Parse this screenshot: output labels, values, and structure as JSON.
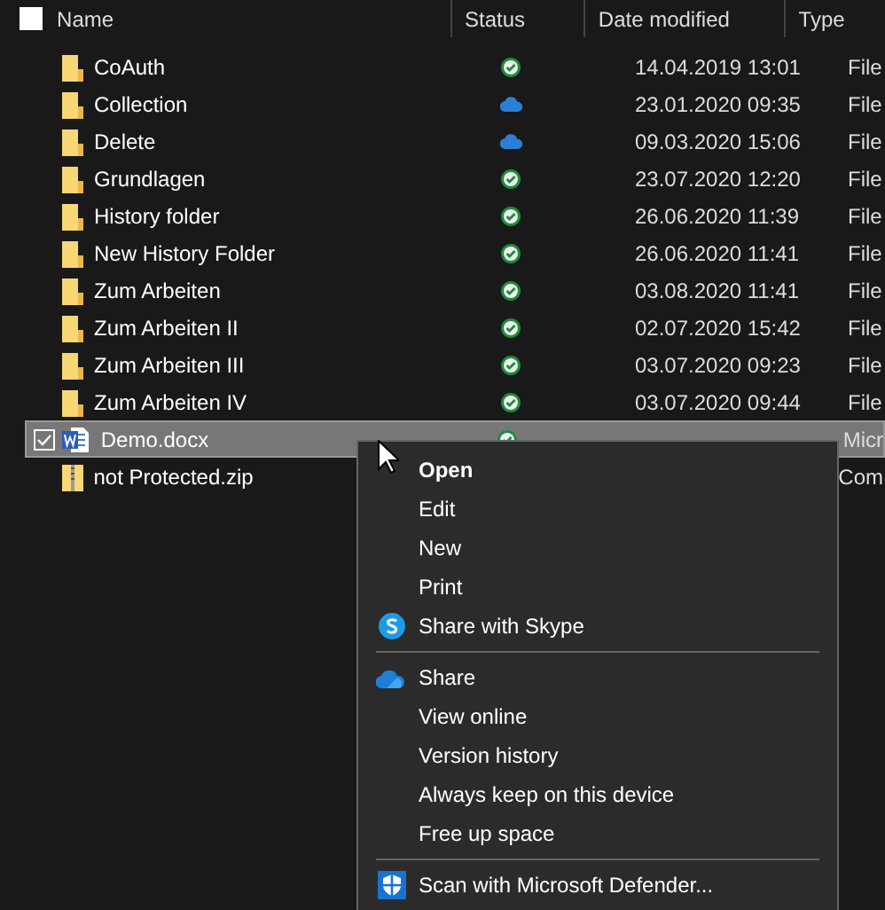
{
  "header": {
    "checked": false,
    "columns": [
      "Name",
      "Status",
      "Date modified",
      "Type"
    ]
  },
  "rows": [
    {
      "name": "CoAuth",
      "kind": "folder",
      "status": {
        "kind": "synced"
      },
      "date": "14.04.2019 13:01",
      "type": "File",
      "selected": false
    },
    {
      "name": "Collection",
      "kind": "folder",
      "status": {
        "kind": "cloud"
      },
      "date": "23.01.2020 09:35",
      "type": "File",
      "selected": false
    },
    {
      "name": "Delete",
      "kind": "folder",
      "status": {
        "kind": "cloud"
      },
      "date": "09.03.2020 15:06",
      "type": "File",
      "selected": false
    },
    {
      "name": "Grundlagen",
      "kind": "folder",
      "status": {
        "kind": "synced"
      },
      "date": "23.07.2020 12:20",
      "type": "File",
      "selected": false
    },
    {
      "name": "History folder",
      "kind": "folder",
      "status": {
        "kind": "synced"
      },
      "date": "26.06.2020 11:39",
      "type": "File",
      "selected": false
    },
    {
      "name": "New History Folder",
      "kind": "folder",
      "status": {
        "kind": "synced"
      },
      "date": "26.06.2020 11:41",
      "type": "File",
      "selected": false
    },
    {
      "name": "Zum Arbeiten",
      "kind": "folder",
      "status": {
        "kind": "synced"
      },
      "date": "03.08.2020 11:41",
      "type": "File",
      "selected": false
    },
    {
      "name": "Zum Arbeiten II",
      "kind": "folder",
      "status": {
        "kind": "synced"
      },
      "date": "02.07.2020 15:42",
      "type": "File",
      "selected": false
    },
    {
      "name": "Zum Arbeiten III",
      "kind": "folder",
      "status": {
        "kind": "synced"
      },
      "date": "03.07.2020 09:23",
      "type": "File",
      "selected": false
    },
    {
      "name": "Zum Arbeiten IV",
      "kind": "folder",
      "status": {
        "kind": "synced"
      },
      "date": "03.07.2020 09:44",
      "type": "File",
      "selected": false
    },
    {
      "name": "Demo.docx",
      "kind": "word",
      "status": {
        "kind": "synced"
      },
      "type": "Micr",
      "selected": true
    },
    {
      "name": "not Protected.zip",
      "kind": "zip",
      "type": "Com",
      "selected": false
    }
  ],
  "context_menu": {
    "groups": [
      [
        {
          "label": "Open",
          "bold": true
        },
        {
          "label": "Edit"
        },
        {
          "label": "New"
        },
        {
          "label": "Print"
        },
        {
          "label": "Share with Skype",
          "kind": "skype"
        }
      ],
      [
        {
          "label": "Share",
          "kind": "onedrive"
        },
        {
          "label": "View online"
        },
        {
          "label": "Version history"
        },
        {
          "label": "Always keep on this device"
        },
        {
          "label": "Free up space"
        }
      ],
      [
        {
          "label": "Scan with Microsoft Defender...",
          "kind": "defender"
        }
      ]
    ]
  }
}
